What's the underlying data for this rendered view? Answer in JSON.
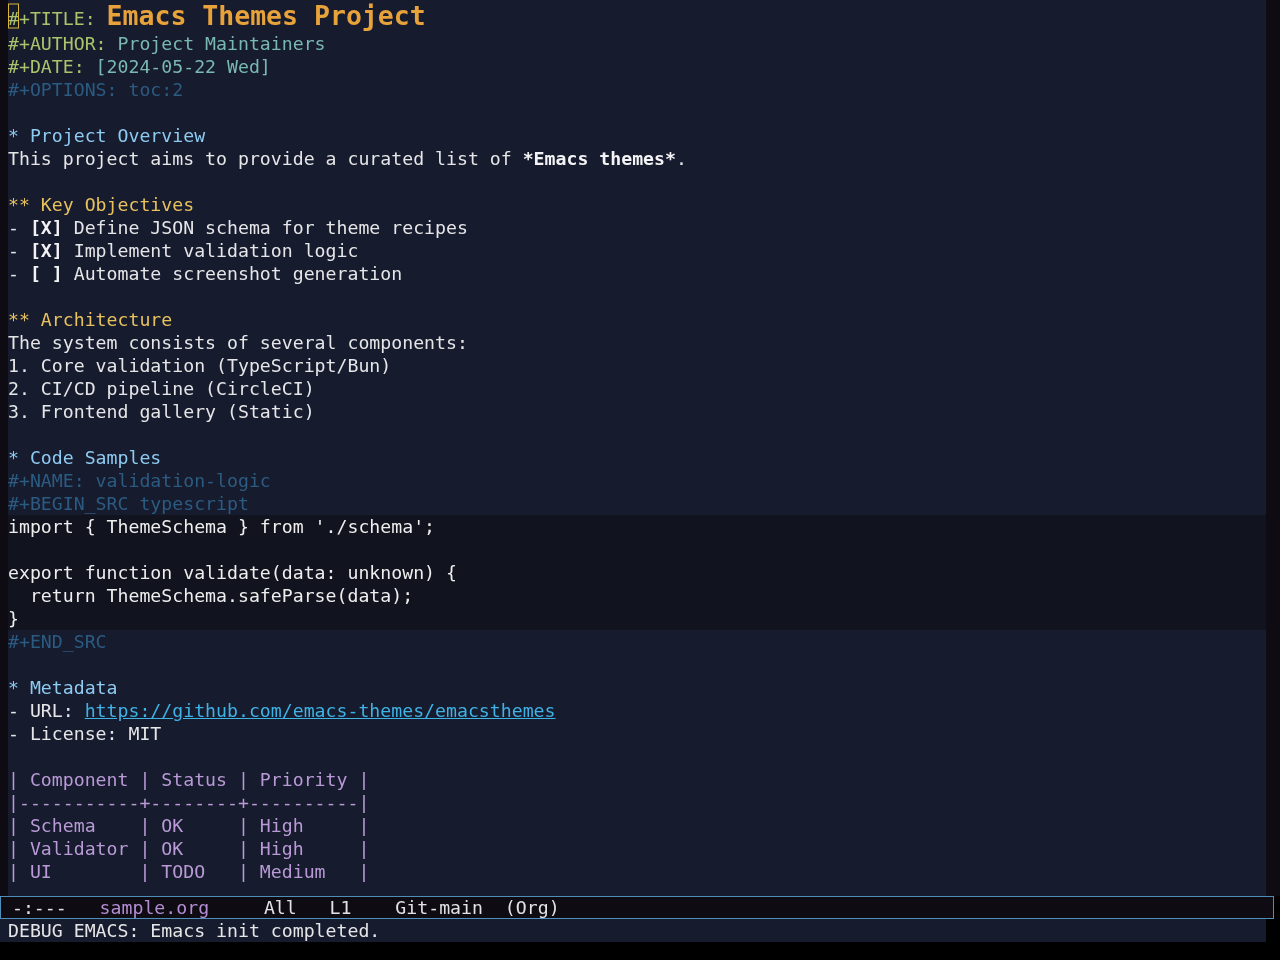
{
  "buffer": {
    "header": [
      {
        "kind": "title",
        "key": "#+TITLE:",
        "value": "Emacs Themes Project",
        "cursor": true
      },
      {
        "kind": "meta",
        "key": "#+AUTHOR:",
        "value": "Project Maintainers",
        "cursor": false
      },
      {
        "kind": "meta",
        "key": "#+DATE:",
        "value": "[2024-05-22 Wed]",
        "cursor": false
      },
      {
        "kind": "directive",
        "text": "#+OPTIONS: toc:2",
        "cursor": false
      }
    ],
    "sections": [
      {
        "marker": "*",
        "title": "Project Overview",
        "body": [
          {
            "kind": "paragraph",
            "segments": [
              {
                "text": "This project aims to provide a curated list of ",
                "bold": false
              },
              {
                "text": "*Emacs themes*",
                "bold": true
              },
              {
                "text": ".",
                "bold": false
              }
            ]
          },
          {
            "kind": "blank"
          }
        ],
        "children": [
          {
            "marker": "**",
            "title": "Key Objectives",
            "body": [
              {
                "kind": "checkbox",
                "bullet": "-",
                "box": "[X]",
                "text": "Define JSON schema for theme recipes"
              },
              {
                "kind": "checkbox",
                "bullet": "-",
                "box": "[X]",
                "text": "Implement validation logic"
              },
              {
                "kind": "checkbox",
                "bullet": "-",
                "box": "[ ]",
                "text": "Automate screenshot generation"
              },
              {
                "kind": "blank"
              }
            ]
          },
          {
            "marker": "**",
            "title": "Architecture",
            "body": [
              {
                "kind": "paragraph",
                "segments": [
                  {
                    "text": "The system consists of several components:",
                    "bold": false
                  }
                ]
              },
              {
                "kind": "list-item",
                "bullet": "1.",
                "text": "Core validation (TypeScript/Bun)"
              },
              {
                "kind": "list-item",
                "bullet": "2.",
                "text": "CI/CD pipeline (CircleCI)"
              },
              {
                "kind": "list-item",
                "bullet": "3.",
                "text": "Frontend gallery (Static)"
              },
              {
                "kind": "blank"
              }
            ]
          }
        ]
      },
      {
        "marker": "*",
        "title": "Code Samples",
        "body": [
          {
            "kind": "directive",
            "text": "#+NAME: validation-logic"
          },
          {
            "kind": "directive",
            "text": "#+BEGIN_SRC typescript"
          },
          {
            "kind": "code",
            "lines": [
              {
                "kind": "text",
                "text": "import { ThemeSchema } from './schema';"
              },
              {
                "kind": "blank"
              },
              {
                "kind": "text",
                "text": "export function validate(data: unknown) {"
              },
              {
                "kind": "text",
                "text": "  return ThemeSchema.safeParse(data);"
              },
              {
                "kind": "text",
                "text": "}"
              }
            ]
          },
          {
            "kind": "directive",
            "text": "#+END_SRC"
          },
          {
            "kind": "blank"
          }
        ]
      },
      {
        "marker": "*",
        "title": "Metadata",
        "body": [
          {
            "kind": "link-item",
            "bullet": "-",
            "label": "URL:",
            "url": "https://github.com/emacs-themes/emacsthemes"
          },
          {
            "kind": "list-item",
            "bullet": "-",
            "text": "License: MIT"
          },
          {
            "kind": "blank"
          },
          {
            "kind": "table",
            "rows": [
              "| Component | Status | Priority |",
              "|-----------+--------+----------|",
              "| Schema    | OK     | High     |",
              "| Validator | OK     | High     |",
              "| UI        | TODO   | Medium   |"
            ]
          }
        ]
      }
    ]
  },
  "mode_line": {
    "status": "-:---",
    "buffer_name": "sample.org",
    "position": "All",
    "line": "L1",
    "branch": "Git-main",
    "mode": "(Org)"
  },
  "echo_area": "DEBUG EMACS: Emacs init completed."
}
